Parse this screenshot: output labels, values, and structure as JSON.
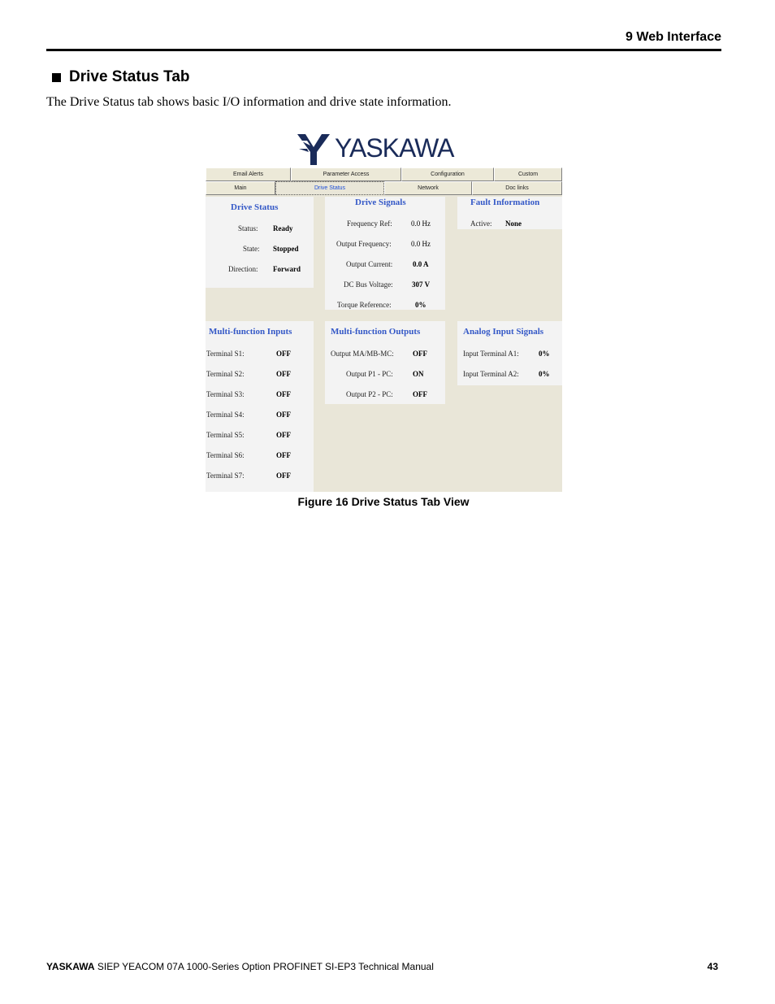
{
  "header": {
    "running_head": "9  Web Interface"
  },
  "section": {
    "title": "Drive Status Tab",
    "intro": "The Drive Status tab shows basic I/O information and drive state information."
  },
  "logo": {
    "text": "YASKAWA"
  },
  "screenshot": {
    "tabs_back": [
      "Email Alerts",
      "Parameter Access",
      "Configuration",
      "Custom"
    ],
    "tabs_front": [
      "Main",
      "Drive Status",
      "Network",
      "Doc links"
    ],
    "active_tab": "Drive Status",
    "drive_status": {
      "title": "Drive Status",
      "rows": [
        {
          "label": "Status:",
          "value": "Ready"
        },
        {
          "label": "State:",
          "value": "Stopped"
        },
        {
          "label": "Direction:",
          "value": "Forward"
        }
      ]
    },
    "drive_signals": {
      "title": "Drive Signals",
      "rows": [
        {
          "label": "Frequency Ref:",
          "value": "0.0 Hz"
        },
        {
          "label": "Output Frequency:",
          "value": "0.0 Hz"
        },
        {
          "label": "Output Current:",
          "value": "0.0 A"
        },
        {
          "label": "DC Bus Voltage:",
          "value": "307 V"
        },
        {
          "label": "Torque Reference:",
          "value": "0%"
        }
      ]
    },
    "fault_information": {
      "title": "Fault Information",
      "rows": [
        {
          "label": "Active:",
          "value": "None"
        }
      ]
    },
    "mf_inputs": {
      "title": "Multi-function Inputs",
      "rows": [
        {
          "label": "Terminal S1:",
          "value": "OFF"
        },
        {
          "label": "Terminal S2:",
          "value": "OFF"
        },
        {
          "label": "Terminal S3:",
          "value": "OFF"
        },
        {
          "label": "Terminal S4:",
          "value": "OFF"
        },
        {
          "label": "Terminal S5:",
          "value": "OFF"
        },
        {
          "label": "Terminal S6:",
          "value": "OFF"
        },
        {
          "label": "Terminal S7:",
          "value": "OFF"
        }
      ]
    },
    "mf_outputs": {
      "title": "Multi-function Outputs",
      "rows": [
        {
          "label": "Output MA/MB-MC:",
          "value": "OFF"
        },
        {
          "label": "Output P1 - PC:",
          "value": "ON"
        },
        {
          "label": "Output P2 - PC:",
          "value": "OFF"
        }
      ]
    },
    "analog_inputs": {
      "title": "Analog Input Signals",
      "rows": [
        {
          "label": "Input Terminal A1:",
          "value": "0%"
        },
        {
          "label": "Input Terminal A2:",
          "value": "0%"
        }
      ]
    }
  },
  "figure": {
    "caption": "Figure 16  Drive Status Tab View"
  },
  "footer": {
    "brand": "YASKAWA",
    "text": " SIEP YEACOM 07A 1000-Series Option PROFINET SI-EP3 Technical Manual",
    "page": "43"
  },
  "colors": {
    "title_blue": "#3559c7",
    "panel_bg": "#e9e6d8",
    "box_bg": "#f3f3f3"
  }
}
